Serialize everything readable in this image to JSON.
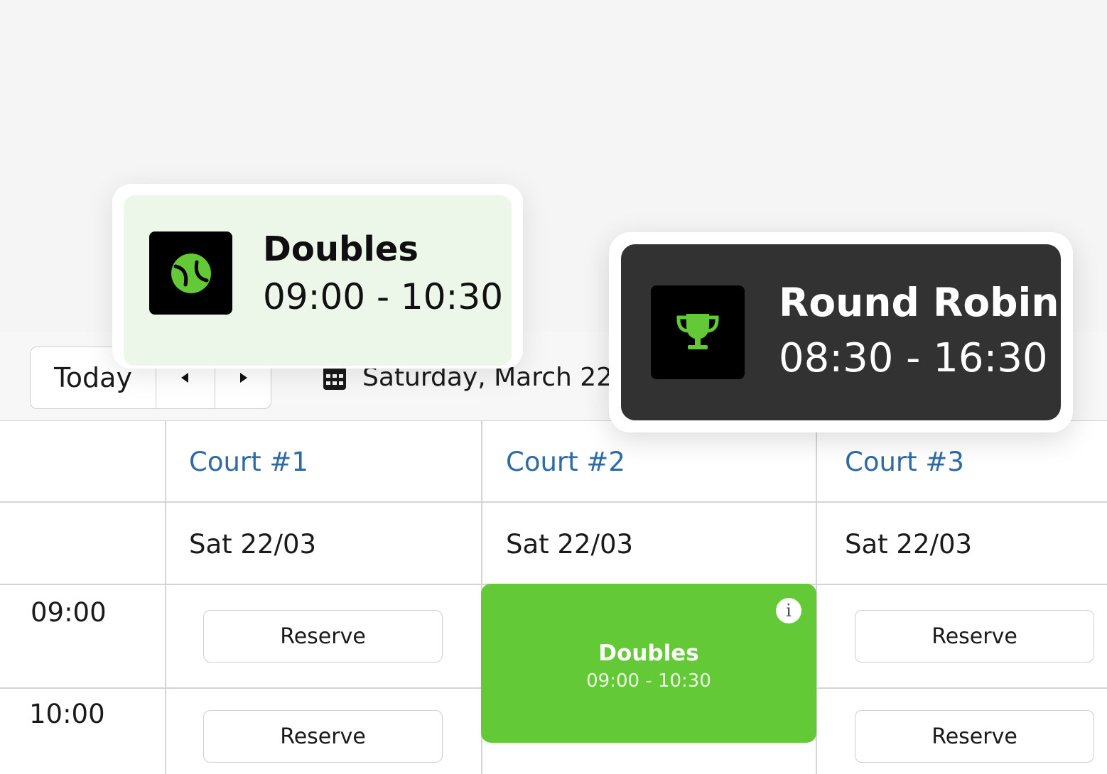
{
  "toolbar": {
    "today_label": "Today",
    "date_label": "Saturday, March 22"
  },
  "courts": [
    {
      "name": "Court #1",
      "day": "Sat 22/03"
    },
    {
      "name": "Court #2",
      "day": "Sat 22/03"
    },
    {
      "name": "Court #3",
      "day": "Sat 22/03"
    }
  ],
  "times": [
    "09:00",
    "10:00"
  ],
  "reserve_label": "Reserve",
  "booking": {
    "title": "Doubles",
    "time": "09:00 - 10:30",
    "info_glyph": "i",
    "color": "#63c936"
  },
  "cards": {
    "doubles": {
      "title": "Doubles",
      "time": "09:00 - 10:30",
      "icon": "tennis-ball-icon",
      "background": "#edf7e9"
    },
    "round_robin": {
      "title": "Round Robin",
      "time": "08:30 - 16:30",
      "icon": "trophy-icon",
      "background": "#313231"
    }
  },
  "colors": {
    "accent_green": "#63c936",
    "court_link": "#2d6aa6"
  }
}
